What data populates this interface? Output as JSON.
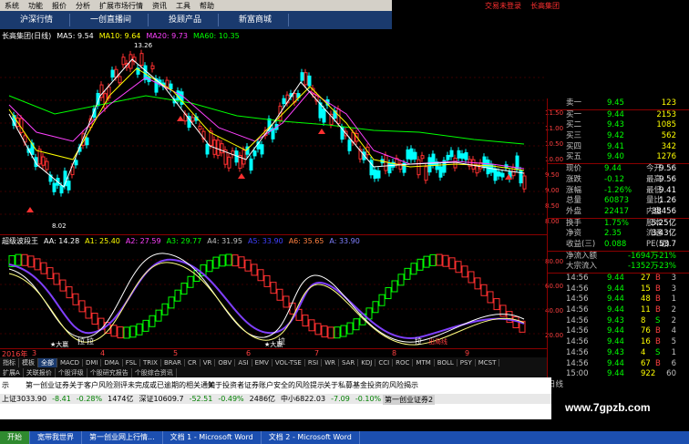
{
  "menu": [
    "系统",
    "功能",
    "报价",
    "分析",
    "扩展市场行情",
    "资讯",
    "工具",
    "帮助"
  ],
  "top_right": {
    "login": "交易未登录",
    "brand": "长高集团"
  },
  "tabs": [
    "沪深行情",
    "一创直播间",
    "投顾产品",
    "新富商城"
  ],
  "kline": {
    "title": "长高集团(日线)",
    "ma_labels": [
      "MA5: 9.54",
      "MA10: 9.64",
      "MA20: 9.73",
      "MA60: 10.35"
    ],
    "ma_colors": {
      "ma5": "#ffffff",
      "ma10": "#ffff00",
      "ma20": "#ff40ff",
      "ma60": "#00ff00"
    },
    "high_label": "13.26",
    "low_label": "8.02",
    "axis": [
      "11.50",
      "11.00",
      "10.50",
      "10.00",
      "9.50",
      "9.00",
      "8.50",
      "8.00"
    ]
  },
  "indicator": {
    "name": "超级波段王",
    "labels": [
      "AA: 14.28",
      "A1: 25.40",
      "A2: 27.59",
      "A3: 29.77",
      "A4: 31.95",
      "A5: 33.90",
      "A6: 35.65",
      "A: 33.90"
    ],
    "axis": [
      "80.00",
      "60.00",
      "40.00",
      "20.00"
    ],
    "marks": [
      "拉",
      "拉",
      "拉",
      "拉",
      "出局线"
    ],
    "stars": [
      "★大赢",
      "★大赢"
    ]
  },
  "dates": [
    "2016年",
    "3",
    "4",
    "5",
    "6",
    "7",
    "8",
    "9"
  ],
  "subtabs": [
    "指标",
    "模板",
    "全部",
    "MACD",
    "DMI",
    "DMA",
    "FSL",
    "TRIX",
    "BRAR",
    "CR",
    "VR",
    "OBV",
    "ASI",
    "EMV",
    "VOL-TSE",
    "RSI",
    "WR",
    "SAR",
    "KDJ",
    "CCI",
    "ROC",
    "MTM",
    "BOLL",
    "PSY",
    "MCST"
  ],
  "subtabs_active": "全部",
  "subtabs2": [
    "扩展A",
    "关联报价",
    "个股评级",
    "个股研究报告",
    "个股综合资讯"
  ],
  "quote": {
    "asks": [
      {
        "label": "卖一",
        "price": "9.45",
        "vol": "123"
      },
      {
        "label": "买一",
        "price": "9.44",
        "vol": "2153"
      },
      {
        "label": "买二",
        "price": "9.43",
        "vol": "1085"
      },
      {
        "label": "买三",
        "price": "9.42",
        "vol": "562"
      },
      {
        "label": "买四",
        "price": "9.41",
        "vol": "342"
      },
      {
        "label": "买五",
        "price": "9.40",
        "vol": "1276"
      }
    ],
    "stats": [
      {
        "l1": "现价",
        "v1": "9.44",
        "l2": "今开",
        "v2": "9.56"
      },
      {
        "l1": "涨跌",
        "v1": "-0.12",
        "l2": "最高",
        "v2": "9.56"
      },
      {
        "l1": "涨幅",
        "v1": "-1.26%",
        "l2": "最低",
        "v2": "9.41"
      },
      {
        "l1": "总量",
        "v1": "60873",
        "l2": "量比",
        "v2": "1.26"
      },
      {
        "l1": "外盘",
        "v1": "22417",
        "l2": "内盘",
        "v2": "38456"
      }
    ],
    "stats2": [
      {
        "l1": "换手",
        "v1": "1.75%",
        "l2": "股本",
        "v2": "5.25亿"
      },
      {
        "l1": "净资",
        "v1": "2.35",
        "l2": "流通",
        "v2": "3.43亿"
      },
      {
        "l1": "收益(三)",
        "v1": "0.088",
        "l2": "PE(动)",
        "v2": "53.7"
      }
    ],
    "flows": [
      {
        "label": "净流入额",
        "value": "-1694万",
        "pct": "-21%"
      },
      {
        "label": "大宗流入",
        "value": "-1352万",
        "pct": "-23%"
      }
    ],
    "ticks": [
      {
        "t": "14:56",
        "p": "9.44",
        "v": "27",
        "d": "B",
        "n": "3"
      },
      {
        "t": "14:56",
        "p": "9.44",
        "v": "15",
        "d": "B",
        "n": "3"
      },
      {
        "t": "14:56",
        "p": "9.44",
        "v": "48",
        "d": "B",
        "n": "1"
      },
      {
        "t": "14:56",
        "p": "9.44",
        "v": "11",
        "d": "B",
        "n": "2"
      },
      {
        "t": "14:56",
        "p": "9.43",
        "v": "8",
        "d": "S",
        "n": "2"
      },
      {
        "t": "14:56",
        "p": "9.44",
        "v": "76",
        "d": "B",
        "n": "4"
      },
      {
        "t": "14:56",
        "p": "9.44",
        "v": "16",
        "d": "B",
        "n": "5"
      },
      {
        "t": "14:56",
        "p": "9.43",
        "v": "4",
        "d": "S",
        "n": "1"
      },
      {
        "t": "14:56",
        "p": "9.44",
        "v": "67",
        "d": "B",
        "n": "6"
      },
      {
        "t": "15:00",
        "p": "9.44",
        "v": "922",
        "d": "",
        "n": "60"
      }
    ],
    "tick_tab": "日线"
  },
  "news": {
    "row1": [
      "示",
      "第一创业证券关于客户风险测评未完成或已逾期的相关通知",
      "关于投资者证券账户安全的风险提示",
      "关于私募基金投资的风险揭示"
    ],
    "row2": [
      "第一创业证券2"
    ]
  },
  "indices": [
    "上证3033.90",
    "-8.41",
    "-0.28%",
    "1474亿",
    "深证10609.7",
    "-52.51",
    "-0.49%",
    "2486亿",
    "中小6822.03",
    "-7.09",
    "-0.10%",
    "1081亿"
  ],
  "taskbar": [
    "开始",
    "宽带我世界",
    "第一创业网上行情...",
    "文档 1 - Microsoft Word",
    "文档 2 - Microsoft Word"
  ],
  "watermark": "www.7gpzb.com"
}
